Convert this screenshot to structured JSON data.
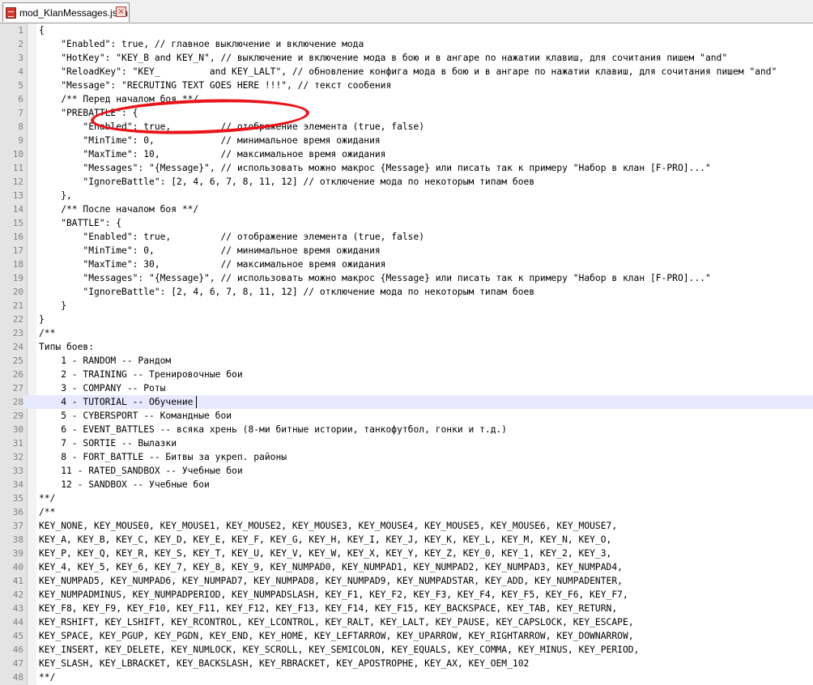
{
  "tab": {
    "title": "mod_KlanMessages.json",
    "close_icon": "×"
  },
  "editor": {
    "current_line": 28,
    "lines": [
      {
        "n": "1",
        "text": "{"
      },
      {
        "n": "2",
        "text": "    \"Enabled\": true, // главное выключение и включение мода"
      },
      {
        "n": "3",
        "text": "    \"HotKey\": \"KEY_B and KEY_N\", // выключение и включение мода в бою и в ангаре по нажатии клавиш, для сочитания пишем \"and\""
      },
      {
        "n": "4",
        "text": "    \"ReloadKey\": \"KEY_         and KEY_LALT\", // обновление конфига мода в бою и в ангаре по нажатии клавиш, для сочитания пишем \"and\""
      },
      {
        "n": "5",
        "text": "    \"Message\": \"RECRUTING TEXT GOES HERE !!!\", // текст сообения"
      },
      {
        "n": "6",
        "text": "    /** Перед началом боя **/"
      },
      {
        "n": "7",
        "text": "    \"PREBATTLE\": {"
      },
      {
        "n": "8",
        "text": "        \"Enabled\": true,         // отображение элемента (true, false)"
      },
      {
        "n": "9",
        "text": "        \"MinTime\": 0,            // минимальное время ожидания"
      },
      {
        "n": "10",
        "text": "        \"MaxTime\": 10,           // максимальное время ожидания"
      },
      {
        "n": "11",
        "text": "        \"Messages\": \"{Message}\", // использовать можно макрос {Message} или писать так к примеру \"Набор в клан [F-PRO]...\""
      },
      {
        "n": "12",
        "text": "        \"IgnoreBattle\": [2, 4, 6, 7, 8, 11, 12] // отключение мода по некоторым типам боев"
      },
      {
        "n": "13",
        "text": "    },"
      },
      {
        "n": "14",
        "text": "    /** После началом боя **/"
      },
      {
        "n": "15",
        "text": "    \"BATTLE\": {"
      },
      {
        "n": "16",
        "text": "        \"Enabled\": true,         // отображение элемента (true, false)"
      },
      {
        "n": "17",
        "text": "        \"MinTime\": 0,            // минимальное время ожидания"
      },
      {
        "n": "18",
        "text": "        \"MaxTime\": 30,           // максимальное время ожидания"
      },
      {
        "n": "19",
        "text": "        \"Messages\": \"{Message}\", // использовать можно макрос {Message} или писать так к примеру \"Набор в клан [F-PRO]...\""
      },
      {
        "n": "20",
        "text": "        \"IgnoreBattle\": [2, 4, 6, 7, 8, 11, 12] // отключение мода по некоторым типам боев"
      },
      {
        "n": "21",
        "text": "    }"
      },
      {
        "n": "22",
        "text": "}"
      },
      {
        "n": "23",
        "text": "/**"
      },
      {
        "n": "24",
        "text": "Типы боев:"
      },
      {
        "n": "25",
        "text": "    1 - RANDOM -- Рандом"
      },
      {
        "n": "26",
        "text": "    2 - TRAINING -- Тренировочные бои"
      },
      {
        "n": "27",
        "text": "    3 - COMPANY -- Роты"
      },
      {
        "n": "28",
        "text": "    4 - TUTORIAL -- Обучение"
      },
      {
        "n": "29",
        "text": "    5 - CYBERSPORT -- Командные бои"
      },
      {
        "n": "30",
        "text": "    6 - EVENT_BATTLES -- всяка хрень (8-ми битные истории, танкофутбол, гонки и т.д.)"
      },
      {
        "n": "31",
        "text": "    7 - SORTIE -- Вылазки"
      },
      {
        "n": "32",
        "text": "    8 - FORT_BATTLE -- Битвы за укреп. районы"
      },
      {
        "n": "33",
        "text": "    11 - RATED_SANDBOX -- Учебные бои"
      },
      {
        "n": "34",
        "text": "    12 - SANDBOX -- Учебные бои"
      },
      {
        "n": "35",
        "text": "**/"
      },
      {
        "n": "36",
        "text": "/**"
      },
      {
        "n": "37",
        "text": "KEY_NONE, KEY_MOUSE0, KEY_MOUSE1, KEY_MOUSE2, KEY_MOUSE3, KEY_MOUSE4, KEY_MOUSE5, KEY_MOUSE6, KEY_MOUSE7,"
      },
      {
        "n": "38",
        "text": "KEY_A, KEY_B, KEY_C, KEY_D, KEY_E, KEY_F, KEY_G, KEY_H, KEY_I, KEY_J, KEY_K, KEY_L, KEY_M, KEY_N, KEY_O,"
      },
      {
        "n": "39",
        "text": "KEY_P, KEY_Q, KEY_R, KEY_S, KEY_T, KEY_U, KEY_V, KEY_W, KEY_X, KEY_Y, KEY_Z, KEY_0, KEY_1, KEY_2, KEY_3,"
      },
      {
        "n": "40",
        "text": "KEY_4, KEY_5, KEY_6, KEY_7, KEY_8, KEY_9, KEY_NUMPAD0, KEY_NUMPAD1, KEY_NUMPAD2, KEY_NUMPAD3, KEY_NUMPAD4,"
      },
      {
        "n": "41",
        "text": "KEY_NUMPAD5, KEY_NUMPAD6, KEY_NUMPAD7, KEY_NUMPAD8, KEY_NUMPAD9, KEY_NUMPADSTAR, KEY_ADD, KEY_NUMPADENTER,"
      },
      {
        "n": "42",
        "text": "KEY_NUMPADMINUS, KEY_NUMPADPERIOD, KEY_NUMPADSLASH, KEY_F1, KEY_F2, KEY_F3, KEY_F4, KEY_F5, KEY_F6, KEY_F7,"
      },
      {
        "n": "43",
        "text": "KEY_F8, KEY_F9, KEY_F10, KEY_F11, KEY_F12, KEY_F13, KEY_F14, KEY_F15, KEY_BACKSPACE, KEY_TAB, KEY_RETURN,"
      },
      {
        "n": "44",
        "text": "KEY_RSHIFT, KEY_LSHIFT, KEY_RCONTROL, KEY_LCONTROL, KEY_RALT, KEY_LALT, KEY_PAUSE, KEY_CAPSLOCK, KEY_ESCAPE,"
      },
      {
        "n": "45",
        "text": "KEY_SPACE, KEY_PGUP, KEY_PGDN, KEY_END, KEY_HOME, KEY_LEFTARROW, KEY_UPARROW, KEY_RIGHTARROW, KEY_DOWNARROW,"
      },
      {
        "n": "46",
        "text": "KEY_INSERT, KEY_DELETE, KEY_NUMLOCK, KEY_SCROLL, KEY_SEMICOLON, KEY_EQUALS, KEY_COMMA, KEY_MINUS, KEY_PERIOD,"
      },
      {
        "n": "47",
        "text": "KEY_SLASH, KEY_LBRACKET, KEY_BACKSLASH, KEY_RBRACKET, KEY_APOSTROPHE, KEY_AX, KEY_OEM_102"
      },
      {
        "n": "48",
        "text": "**/"
      }
    ]
  }
}
